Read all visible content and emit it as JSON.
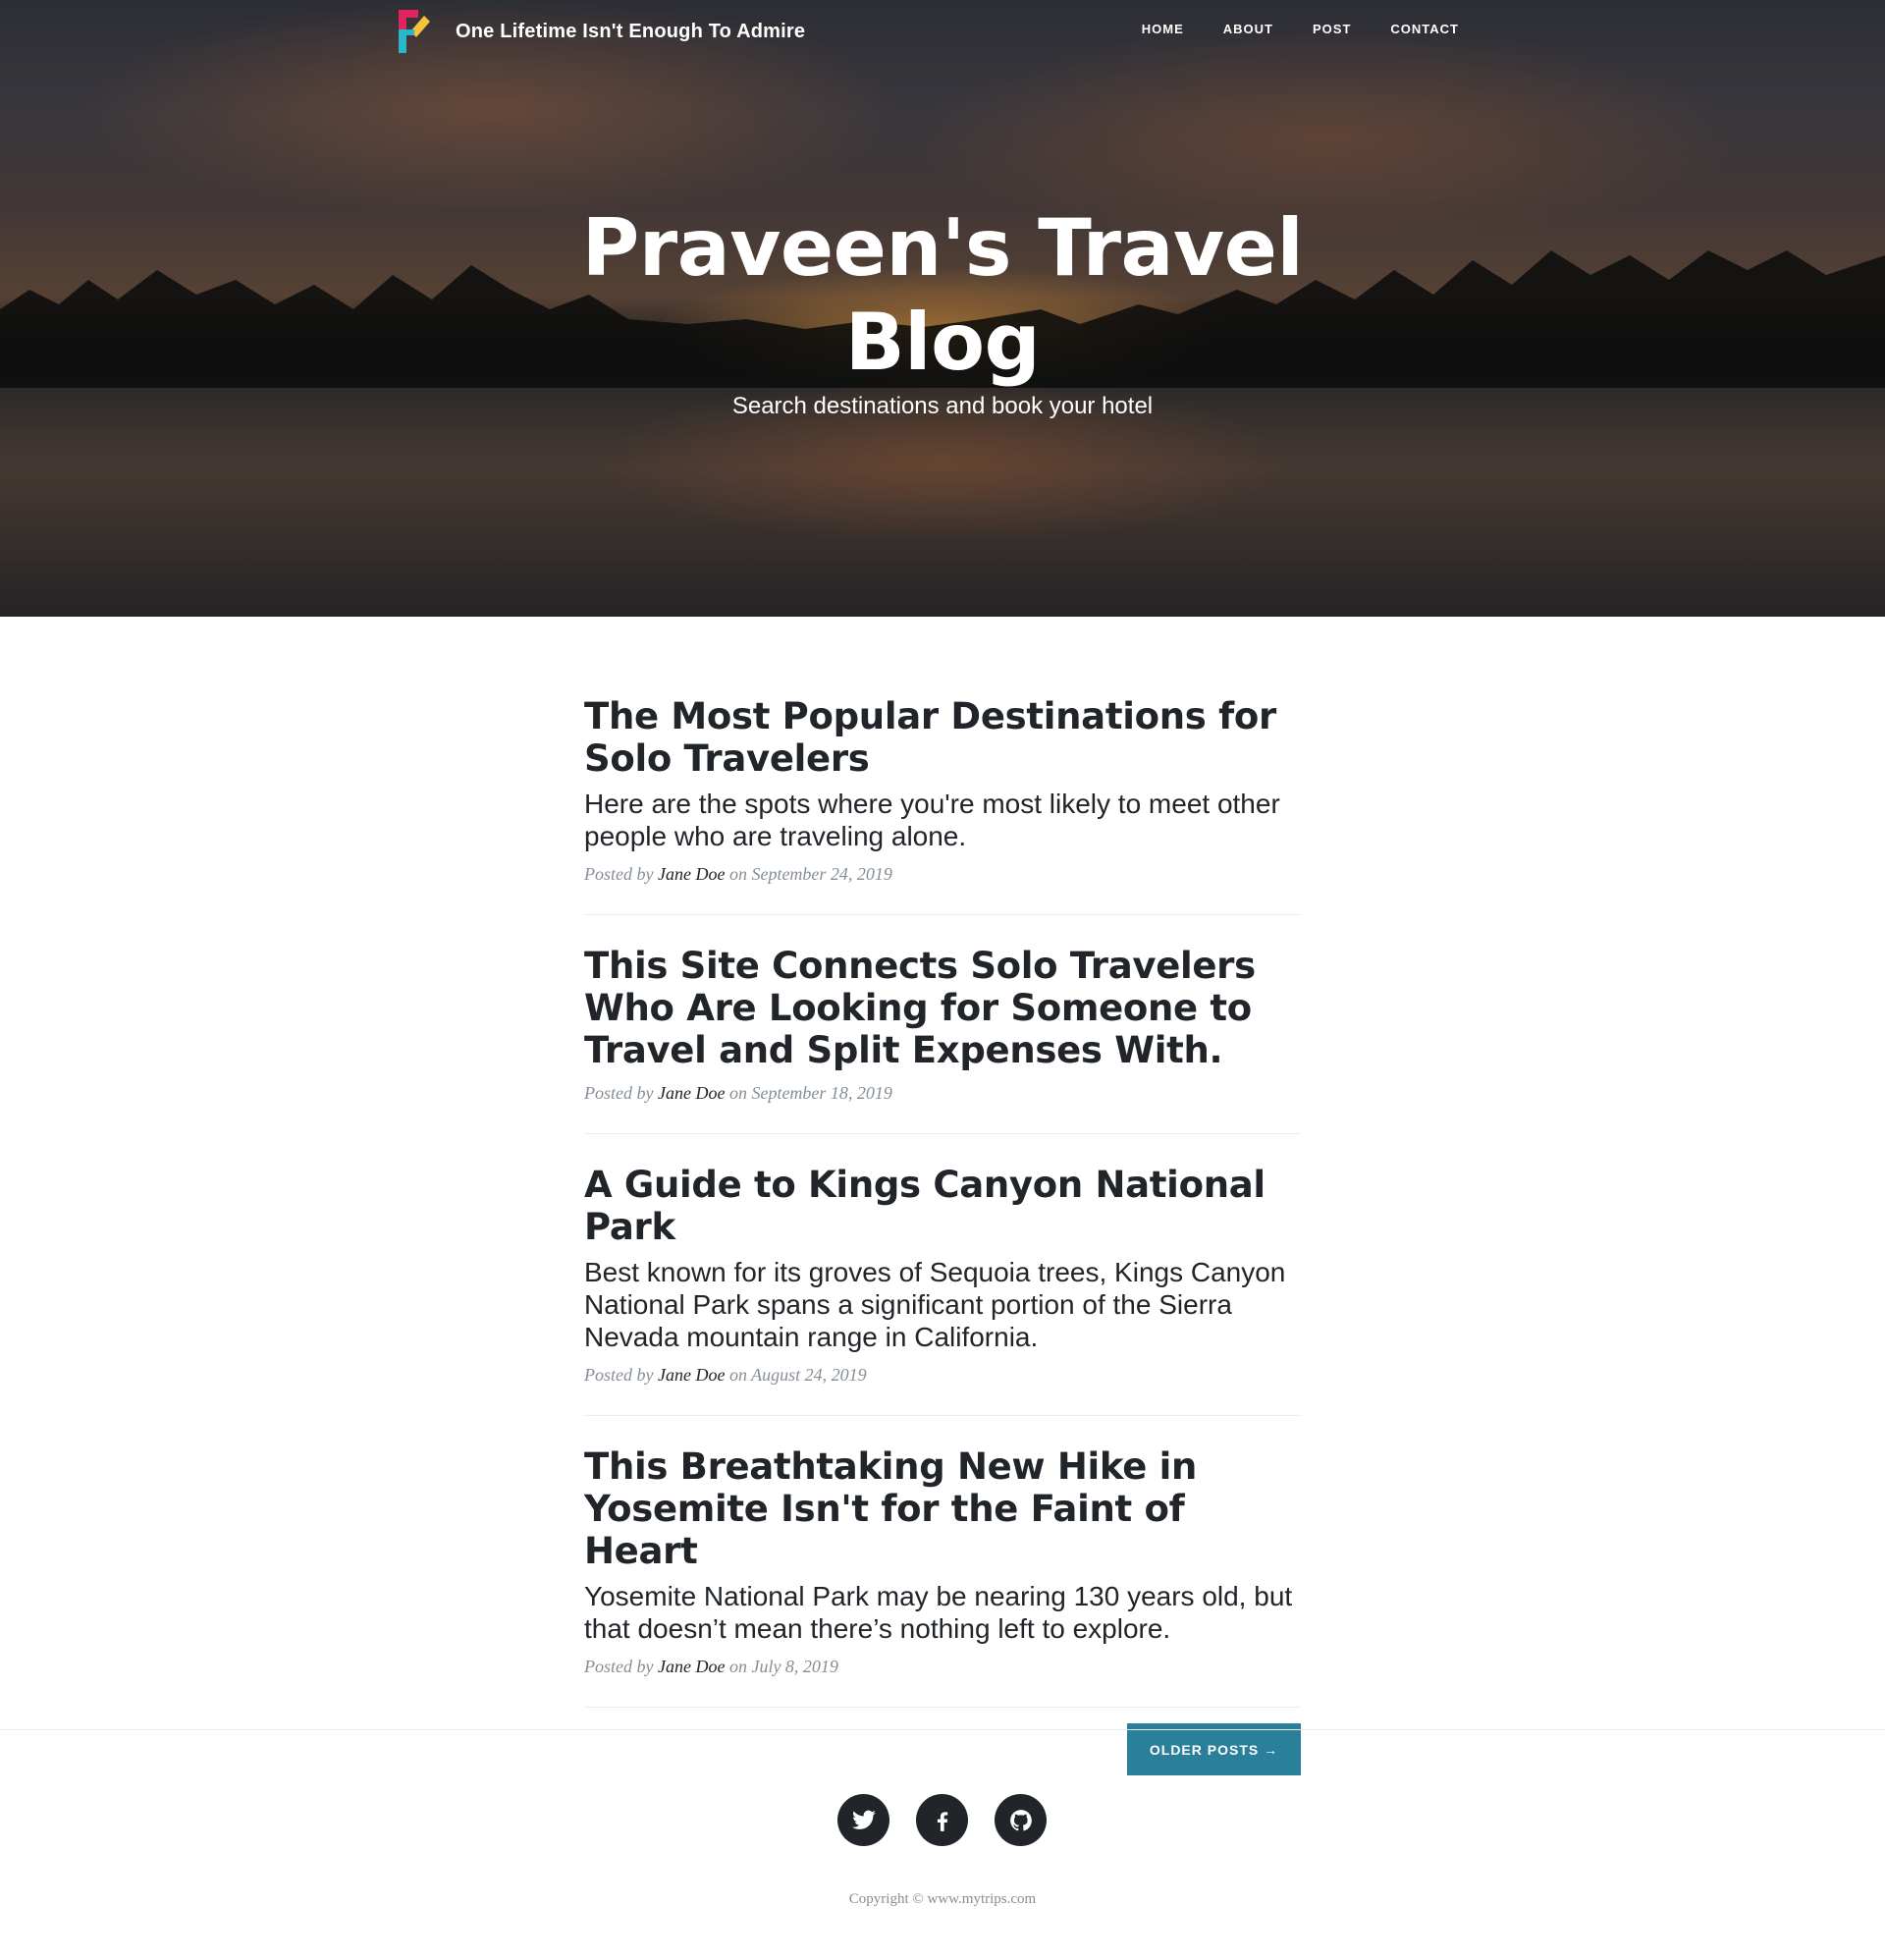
{
  "brand": {
    "title": "One Lifetime Isn't Enough To Admire"
  },
  "nav": {
    "items": [
      {
        "label": "HOME"
      },
      {
        "label": "ABOUT"
      },
      {
        "label": "POST"
      },
      {
        "label": "CONTACT"
      }
    ]
  },
  "hero": {
    "title": "Praveen's Travel Blog",
    "subtitle": "Search destinations and book your hotel"
  },
  "posts": [
    {
      "title": "The Most Popular Destinations for Solo Travelers",
      "subtitle": "Here are the spots where you're most likely to meet other people who are traveling alone.",
      "meta_prefix": "Posted by",
      "author": "Jane Doe",
      "meta_on": "on",
      "date": "September 24, 2019"
    },
    {
      "title": "This Site Connects Solo Travelers Who Are Looking for Someone to Travel and Split Expenses With.",
      "subtitle": "",
      "meta_prefix": "Posted by",
      "author": "Jane Doe",
      "meta_on": "on",
      "date": "September 18, 2019"
    },
    {
      "title": "A Guide to Kings Canyon National Park",
      "subtitle": "Best known for its groves of Sequoia trees, Kings Canyon National Park spans a significant portion of the Sierra Nevada mountain range in California.",
      "meta_prefix": "Posted by",
      "author": "Jane Doe",
      "meta_on": "on",
      "date": "August 24, 2019"
    },
    {
      "title": "This Breathtaking New Hike in Yosemite Isn't for the Faint of Heart",
      "subtitle": "Yosemite National Park may be nearing 130 years old, but that doesn’t mean there’s nothing left to explore.",
      "meta_prefix": "Posted by",
      "author": "Jane Doe",
      "meta_on": "on",
      "date": "July 8, 2019"
    }
  ],
  "pagination": {
    "older_label": "OLDER POSTS →"
  },
  "footer": {
    "social": [
      {
        "icon": "twitter-icon"
      },
      {
        "icon": "facebook-icon"
      },
      {
        "icon": "github-icon"
      }
    ],
    "copyright": "Copyright © www.mytrips.com"
  },
  "colors": {
    "accent": "#2a7f9b",
    "text": "#212529",
    "muted": "#868e96"
  }
}
